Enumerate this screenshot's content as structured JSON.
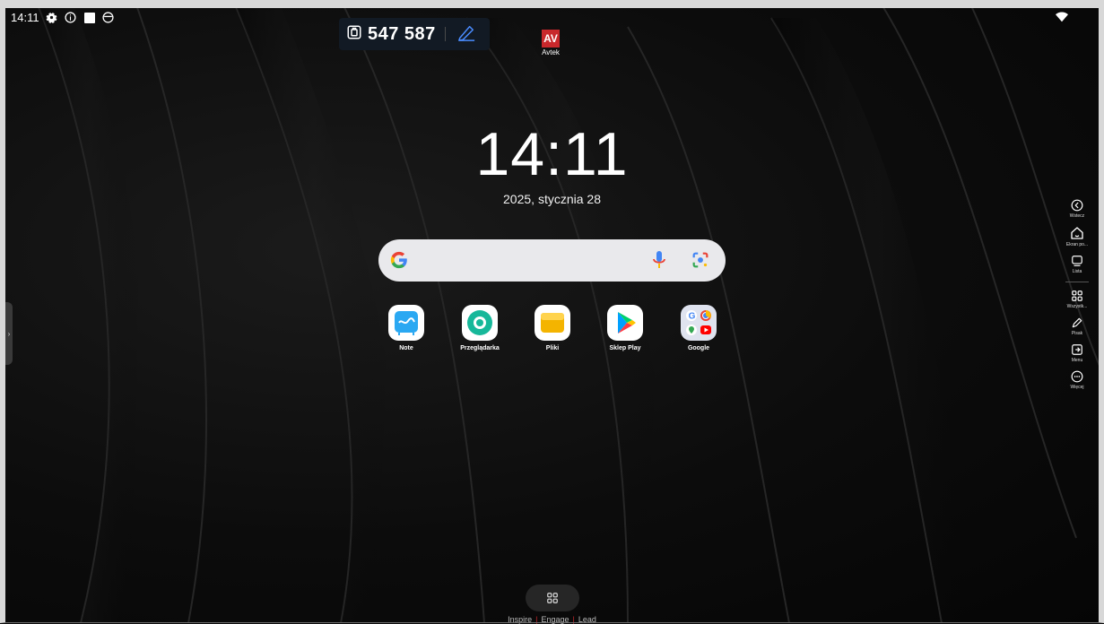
{
  "status_bar": {
    "time": "14:11",
    "icons": [
      "settings-gear-icon",
      "info-circle-icon",
      "square-icon",
      "screen-record-icon"
    ],
    "right_icons": [
      "wifi-icon"
    ]
  },
  "share_code": {
    "code": "547 587",
    "icons": [
      "cast-icon",
      "pen-edit-icon"
    ]
  },
  "logo": {
    "mark": "AV",
    "name": "Avtek",
    "color": "#c8282c"
  },
  "clock": {
    "time": "14:11",
    "date": "2025, stycznia 28"
  },
  "search": {
    "icons": [
      "google-g-icon",
      "microphone-icon",
      "google-lens-icon"
    ]
  },
  "apps": [
    {
      "label": "Note",
      "icon": "note-icon"
    },
    {
      "label": "Przeglądarka",
      "icon": "browser-icon"
    },
    {
      "label": "Pliki",
      "icon": "files-icon"
    },
    {
      "label": "Sklep Play",
      "icon": "play-store-icon"
    },
    {
      "label": "Google",
      "icon": "google-folder-icon"
    }
  ],
  "right_nav": {
    "items": [
      {
        "label": "Wstecz",
        "icon": "back-icon"
      },
      {
        "label": "Ekran po...",
        "icon": "home-icon"
      },
      {
        "label": "Lista",
        "icon": "recent-apps-icon"
      },
      {
        "label": "Wszystk...",
        "icon": "all-apps-icon"
      },
      {
        "label": "Pisak",
        "icon": "pen-icon"
      },
      {
        "label": "Menu",
        "icon": "menu-exit-icon"
      },
      {
        "label": "Więcej",
        "icon": "more-icon"
      }
    ]
  },
  "left_tab": {
    "glyph": "›"
  },
  "bottom": {
    "tagline": [
      "Inspire",
      "Engage",
      "Lead"
    ],
    "drawer_icon": "app-drawer-icon"
  },
  "colors": {
    "accent_blue": "#4a8cff",
    "brand_red": "#c8282c",
    "search_bg": "#e9e9ec"
  }
}
